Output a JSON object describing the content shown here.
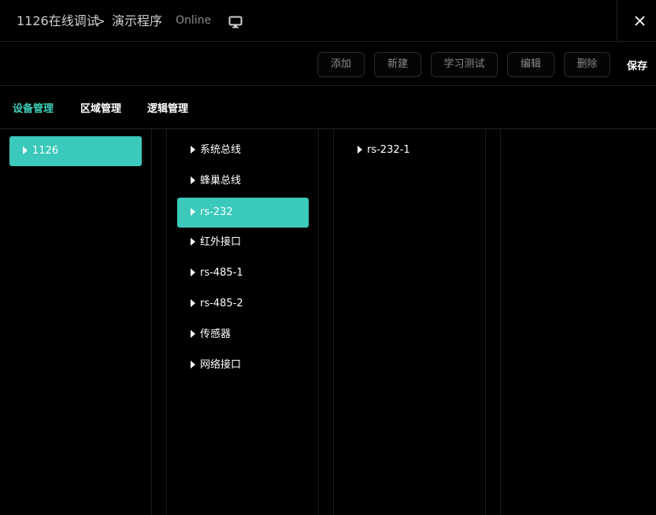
{
  "header": {
    "breadcrumb_root": "1126在线调试",
    "breadcrumb_separator": ">",
    "breadcrumb_current": "演示程序",
    "status": "Online",
    "monitor_icon": "monitor-icon",
    "close_icon": "close-icon"
  },
  "toolbar": {
    "add_label": "添加",
    "new_label": "新建",
    "learn_test_label": "学习测试",
    "edit_label": "编辑",
    "delete_label": "删除",
    "save_label": "保存"
  },
  "tabs": [
    {
      "label": "设备管理",
      "active": true
    },
    {
      "label": "区域管理",
      "active": false
    },
    {
      "label": "逻辑管理",
      "active": false
    }
  ],
  "columns": {
    "devices": [
      {
        "label": "1126",
        "selected": true
      }
    ],
    "buses": [
      {
        "label": "系统总线",
        "selected": false
      },
      {
        "label": "蜂巢总线",
        "selected": false
      },
      {
        "label": "rs-232",
        "selected": true
      },
      {
        "label": "红外接口",
        "selected": false
      },
      {
        "label": "rs-485-1",
        "selected": false
      },
      {
        "label": "rs-485-2",
        "selected": false
      },
      {
        "label": "传感器",
        "selected": false
      },
      {
        "label": "网络接口",
        "selected": false
      }
    ],
    "ports": [
      {
        "label": "rs-232-1",
        "selected": false
      }
    ]
  },
  "colors": {
    "background": "#000000",
    "accent": "#3ecfba",
    "selected_fill": "#3ac9bb",
    "divider": "#1f1f1f",
    "muted_text": "#8c8c8c"
  }
}
